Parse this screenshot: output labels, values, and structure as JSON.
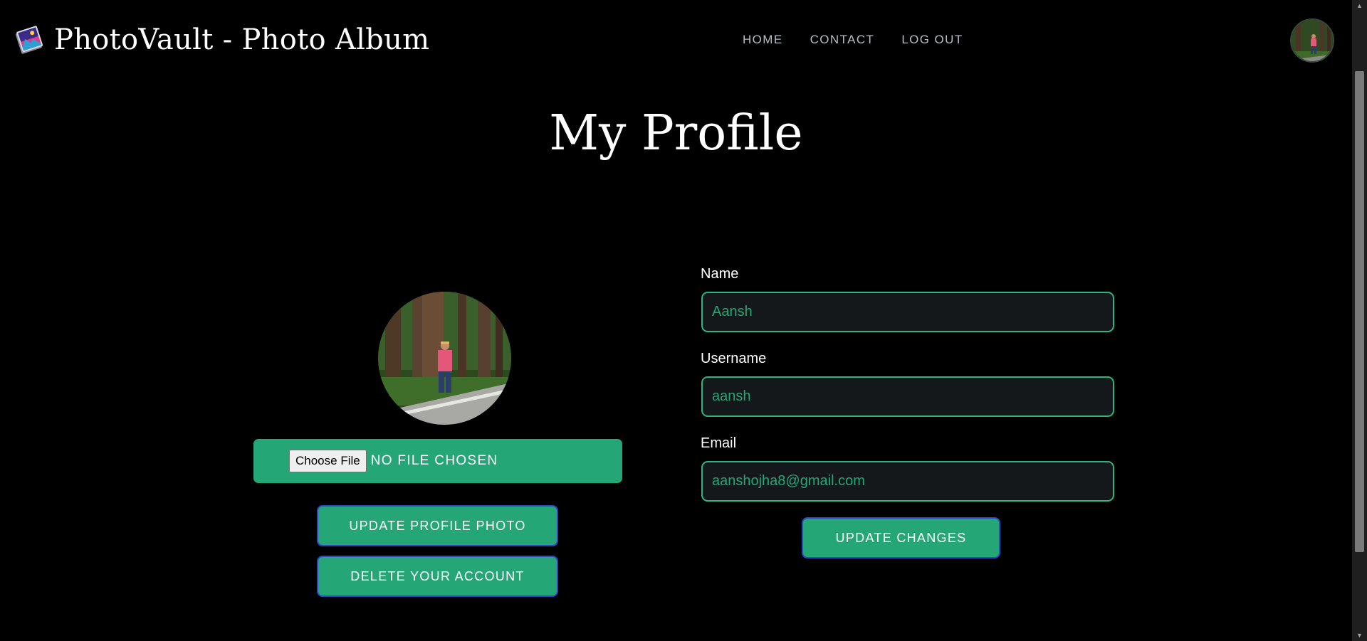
{
  "header": {
    "brand_title": "PhotoVault - Photo Album",
    "logo_icon": "photo-album-icon",
    "nav": [
      {
        "label": "HOME"
      },
      {
        "label": "CONTACT"
      },
      {
        "label": "LOG OUT"
      }
    ]
  },
  "page": {
    "title": "My Profile"
  },
  "photo_panel": {
    "choose_file_label": "Choose File",
    "file_status": "NO FILE CHOSEN",
    "update_photo_label": "UPDATE PROFILE PHOTO",
    "delete_account_label": "DELETE YOUR ACCOUNT"
  },
  "form": {
    "name_label": "Name",
    "name_value": "Aansh",
    "username_label": "Username",
    "username_value": "aansh",
    "email_label": "Email",
    "email_value": "aanshojha8@gmail.com",
    "submit_label": "UPDATE CHANGES"
  },
  "colors": {
    "background": "#000000",
    "accent": "#25a676",
    "button_border": "#2c48c9",
    "input_bg": "#15181a"
  }
}
